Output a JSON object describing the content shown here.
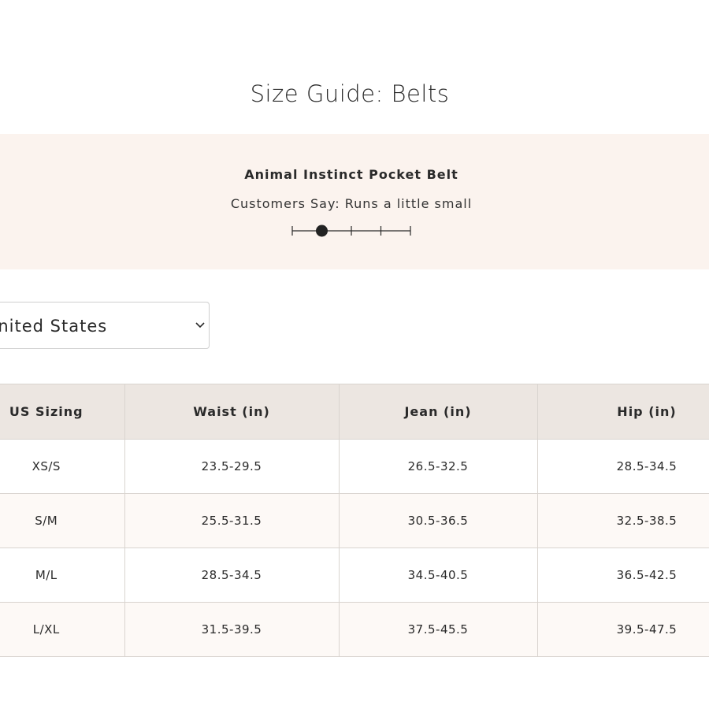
{
  "page": {
    "title": "Size Guide: Belts"
  },
  "fit": {
    "product_name": "Animal Instinct Pocket Belt",
    "customers_say": "Customers Say: Runs a little small",
    "scale_steps": 5,
    "selected_step_index": 1,
    "icons": {
      "indicator": "fit-scale-indicator-dot"
    }
  },
  "country_select": {
    "value": "United States",
    "icon": "chevron-down-icon"
  },
  "size_table": {
    "headers": [
      "US Sizing",
      "Waist (in)",
      "Jean (in)",
      "Hip (in)"
    ],
    "rows": [
      [
        "XS/S",
        "23.5-29.5",
        "26.5-32.5",
        "28.5-34.5"
      ],
      [
        "S/M",
        "25.5-31.5",
        "30.5-36.5",
        "32.5-38.5"
      ],
      [
        "M/L",
        "28.5-34.5",
        "34.5-40.5",
        "36.5-42.5"
      ],
      [
        "L/XL",
        "31.5-39.5",
        "37.5-45.5",
        "39.5-47.5"
      ]
    ]
  },
  "colors": {
    "banner_bg": "#fbf3ee",
    "header_bg": "#ece6e1",
    "text": "#2a2a2a",
    "border": "#d9d4cf"
  }
}
